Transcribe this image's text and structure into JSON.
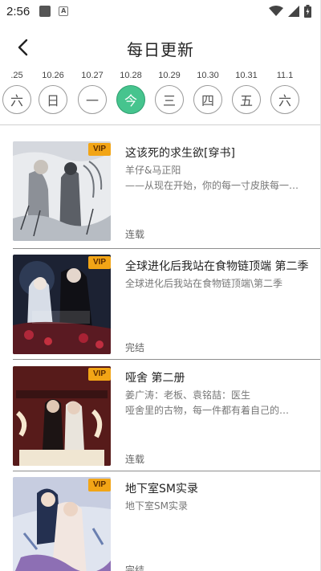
{
  "status_bar": {
    "time": "2:56"
  },
  "header": {
    "title": "每日更新"
  },
  "dates": [
    {
      "date": ".25",
      "day": "六",
      "active": false
    },
    {
      "date": "10.26",
      "day": "日",
      "active": false
    },
    {
      "date": "10.27",
      "day": "一",
      "active": false
    },
    {
      "date": "10.28",
      "day": "今",
      "active": true
    },
    {
      "date": "10.29",
      "day": "三",
      "active": false
    },
    {
      "date": "10.30",
      "day": "四",
      "active": false
    },
    {
      "date": "10.31",
      "day": "五",
      "active": false
    },
    {
      "date": "11.1",
      "day": "六",
      "active": false
    }
  ],
  "items": [
    {
      "title": "这该死的求生欲[穿书]",
      "line1": "羊仔&马正阳",
      "line2": "——从现在开始，你的每一寸皮肤每一…",
      "status": "连载",
      "badge": "VIP"
    },
    {
      "title": "全球进化后我站在食物链顶端 第二季",
      "line1": "全球进化后我站在食物链顶端\\第二季",
      "line2": "",
      "status": "完结",
      "badge": "VIP"
    },
    {
      "title": "哑舍 第二册",
      "line1": "姜广涛：老板、袁铭喆：医生",
      "line2": "哑舍里的古物，每一件都有着自己的…",
      "status": "连载",
      "badge": "VIP"
    },
    {
      "title": "地下室SM实录",
      "line1": "地下室SM实录",
      "line2": "",
      "status": "完结",
      "badge": "VIP"
    }
  ],
  "colors": {
    "active_day": "#46c48e",
    "vip_badge": "#f2a516"
  }
}
